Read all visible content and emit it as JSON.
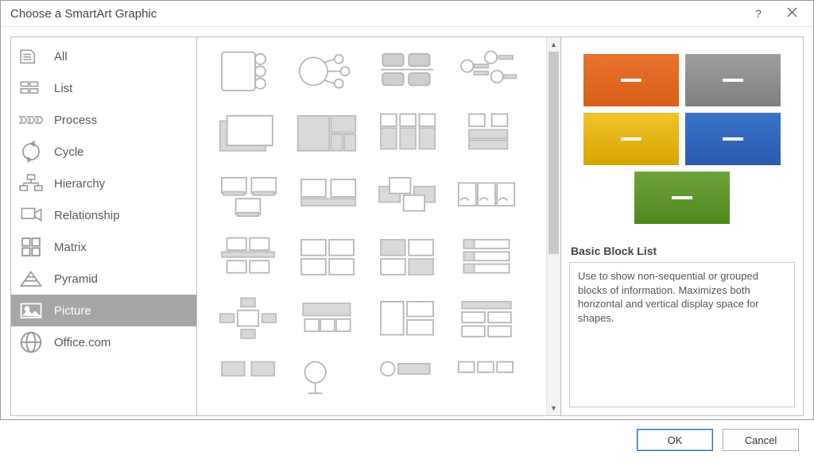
{
  "window": {
    "title": "Choose a SmartArt Graphic",
    "help_label": "?",
    "close_label": "Close"
  },
  "categories": [
    {
      "id": "all",
      "label": "All",
      "selected": false
    },
    {
      "id": "list",
      "label": "List",
      "selected": false
    },
    {
      "id": "process",
      "label": "Process",
      "selected": false
    },
    {
      "id": "cycle",
      "label": "Cycle",
      "selected": false
    },
    {
      "id": "hierarchy",
      "label": "Hierarchy",
      "selected": false
    },
    {
      "id": "relationship",
      "label": "Relationship",
      "selected": false
    },
    {
      "id": "matrix",
      "label": "Matrix",
      "selected": false
    },
    {
      "id": "pyramid",
      "label": "Pyramid",
      "selected": false
    },
    {
      "id": "picture",
      "label": "Picture",
      "selected": true
    },
    {
      "id": "officecom",
      "label": "Office.com",
      "selected": false
    }
  ],
  "gallery": {
    "rows_visible": 6,
    "cols": 4
  },
  "description": {
    "title": "Basic Block List",
    "body": "Use to show non-sequential or grouped blocks of information. Maximizes both horizontal and vertical display space for shapes.",
    "preview_colors": [
      "orange",
      "grey",
      "yellow",
      "blue",
      "green"
    ]
  },
  "buttons": {
    "ok": "OK",
    "cancel": "Cancel"
  }
}
